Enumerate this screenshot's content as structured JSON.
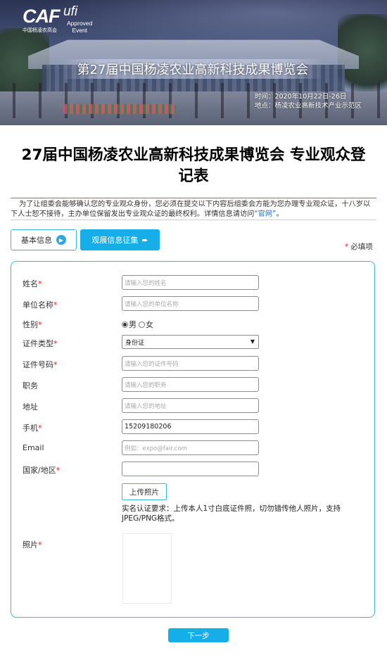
{
  "banner": {
    "logo_caf": "CAF",
    "logo_caf_sub": "中国杨凌农高会",
    "logo_ufi": "ufi",
    "logo_approved_1": "Approved",
    "logo_approved_2": "Event",
    "title": "第27届中国杨凌农业高新科技成果博览会",
    "time": "时间：2020年10月22日-26日",
    "location": "地点：杨凌农业高新技术产业示范区"
  },
  "heading": "27届中国杨凌农业高新科技成果博览会 专业观众登记表",
  "intro": {
    "text": "为了让组委会能够确认您的专业观众身份，您必须在提交以下内容后组委会方能为您办理专业观众证，十八岁以下人士恕不接待，主办单位保留发出专业观众证的最终权利。详情信息请访问",
    "link": "“官网”",
    "tail": "。"
  },
  "tabs": {
    "basic_label": "基本信息",
    "basic_icon": "▶",
    "visit_label": "观展信息征集",
    "visit_icon": "➨"
  },
  "required_note": {
    "star": "*",
    "text": "必填项"
  },
  "form": {
    "name": {
      "label": "姓名",
      "star": "*",
      "placeholder": "请输入您的姓名"
    },
    "company": {
      "label": "单位名称",
      "star": "*",
      "placeholder": "请输入您的单位名称"
    },
    "gender": {
      "label": "性别",
      "star": "*",
      "option_male": "男",
      "option_female": "女"
    },
    "id_type": {
      "label": "证件类型",
      "star": "*",
      "value": "身份证",
      "caret": "▼"
    },
    "id_number": {
      "label": "证件号码",
      "star": "*",
      "placeholder": "请输入您的证件号码"
    },
    "position": {
      "label": "职务",
      "placeholder": "请输入您的职务"
    },
    "address": {
      "label": "地址",
      "placeholder": "请输入您的地址"
    },
    "phone": {
      "label": "手机",
      "star": "*",
      "value": "15209180206"
    },
    "email": {
      "label": "Email",
      "placeholder": "例如：expo@fair.com"
    },
    "country": {
      "label": "国家/地区",
      "star": "*",
      "value": ""
    },
    "upload_button": "上传照片",
    "upload_note": "实名认证要求：上传本人1寸白底证件照，切勿错传他人照片，支持JPEG/PNG格式。",
    "photo": {
      "label": "照片",
      "star": "*"
    }
  },
  "next_button": "下一步"
}
